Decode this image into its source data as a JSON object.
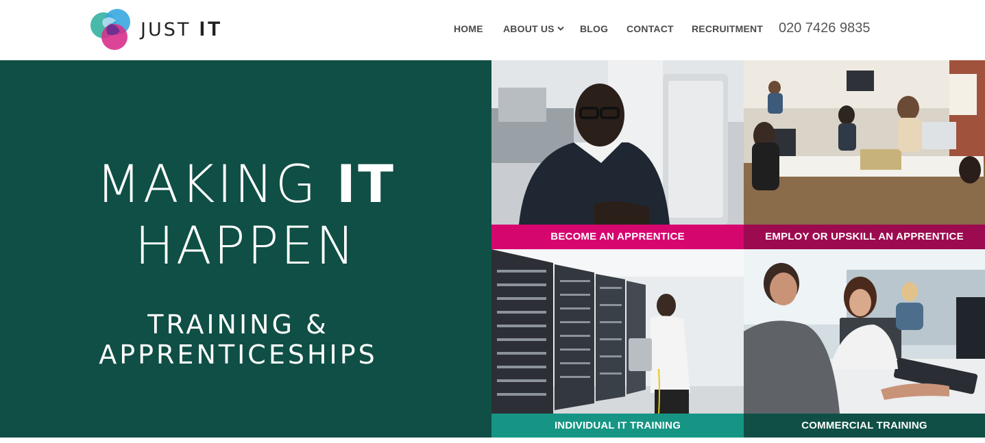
{
  "brand": {
    "name_light": "JUST",
    "name_bold": "IT",
    "colors": {
      "teal": "#3fb5a5",
      "blue": "#3aa7e0",
      "purple": "#6a2f8e",
      "pink": "#d8318c"
    }
  },
  "nav": {
    "items": [
      {
        "label": "HOME"
      },
      {
        "label": "ABOUT US",
        "has_dropdown": true
      },
      {
        "label": "BLOG"
      },
      {
        "label": "CONTACT"
      },
      {
        "label": "RECRUITMENT"
      }
    ],
    "dropdown_icon": "chevron-down-icon",
    "phone": "020 7426 9835"
  },
  "hero": {
    "line1_light": "MAKING ",
    "line1_bold": "IT",
    "line2": "HAPPEN",
    "sub1": "TRAINING &",
    "sub2": "APPRENTICESHIPS",
    "background": "#0f4f45"
  },
  "tiles": [
    {
      "label": "BECOME AN APPRENTICE",
      "color": "#d6066f",
      "image": "man-with-glasses-at-computer"
    },
    {
      "label": "EMPLOY OR UPSKILL AN APPRENTICE",
      "color": "#9c0b4f",
      "image": "busy-open-plan-office"
    },
    {
      "label": "INDIVIDUAL IT TRAINING",
      "color": "#169584",
      "image": "server-room-technician"
    },
    {
      "label": "COMMERCIAL TRAINING",
      "color": "#0f4f45",
      "image": "students-at-computers"
    }
  ]
}
